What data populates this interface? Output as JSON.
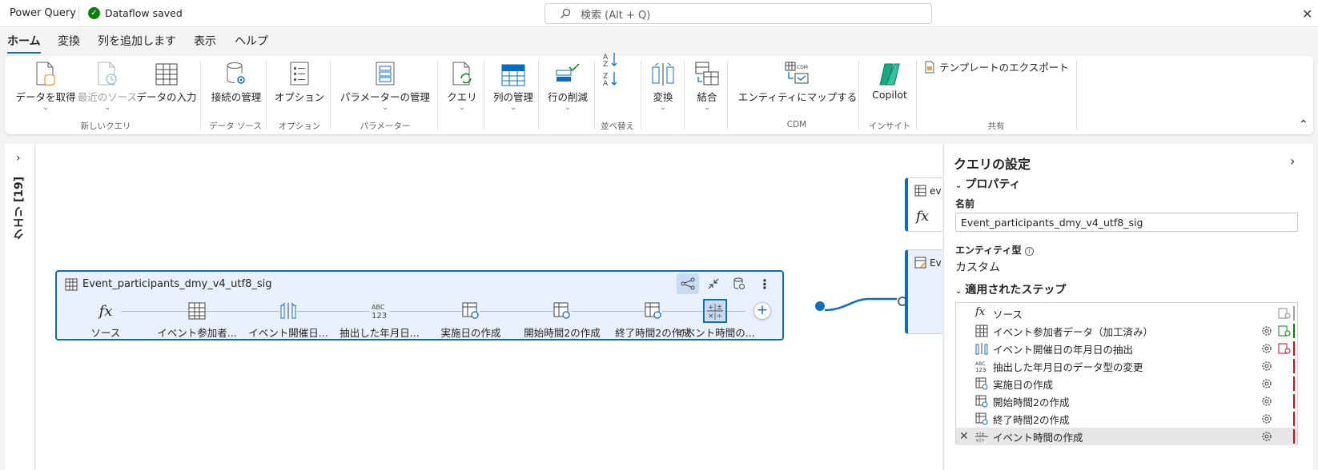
{
  "titlebar": {
    "app_name": "Power Query",
    "save_status": "Dataflow saved",
    "search_placeholder": "検索 (Alt + Q)"
  },
  "tabs": [
    {
      "label": "ホーム",
      "active": true
    },
    {
      "label": "変換"
    },
    {
      "label": "列を追加します"
    },
    {
      "label": "表示"
    },
    {
      "label": "ヘルプ"
    }
  ],
  "ribbon": {
    "get_data": "データを取得",
    "recent_sources": "最近のソース",
    "enter_data": "データの入力",
    "manage_connections": "接続の管理",
    "options": "オプション",
    "manage_parameters": "パラメーターの管理",
    "query": "クエリ",
    "manage_columns": "列の管理",
    "reduce_rows": "行の削減",
    "transform": "変換",
    "combine": "結合",
    "map_to_entity": "エンティティにマップする",
    "copilot": "Copilot",
    "export_template": "テンプレートのエクスポート",
    "groups": {
      "new_query": "新しいクエリ",
      "data_source": "データ ソース",
      "options": "オプション",
      "parameters": "パラメーター",
      "sort": "並べ替え",
      "cdm": "CDM",
      "insight": "インサイト",
      "share": "共有"
    }
  },
  "queries_pane": {
    "label": "クエリ [19]"
  },
  "diagram": {
    "query_name": "Event_participants_dmy_v4_utf8_sig",
    "steps": [
      {
        "label": "ソース",
        "icon": "fx-icon"
      },
      {
        "label": "イベント参加者...",
        "icon": "table-icon"
      },
      {
        "label": "イベント開催日...",
        "icon": "split-column-icon"
      },
      {
        "label": "抽出した年月日...",
        "icon": "abc123-icon"
      },
      {
        "label": "実施日の作成",
        "icon": "custom-column-icon"
      },
      {
        "label": "開始時間2の作成",
        "icon": "custom-column-icon"
      },
      {
        "label": "終了時間2の作成",
        "icon": "custom-column-icon"
      },
      {
        "label": "イベント時間の...",
        "icon": "formula-icon",
        "selected": true
      }
    ],
    "partial_cards": [
      {
        "title": "ev"
      },
      {
        "title": "Ev"
      }
    ]
  },
  "settings": {
    "title": "クエリの設定",
    "properties_header": "プロパティ",
    "name_label": "名前",
    "name_value": "Event_participants_dmy_v4_utf8_sig",
    "entity_type_label": "エンティティ型",
    "entity_type_value": "カスタム",
    "applied_steps_header": "適用されたステップ",
    "applied_steps": [
      {
        "label": "ソース",
        "icon": "fx-icon"
      },
      {
        "label": "イベント参加者データ（加工済み）",
        "icon": "table-icon"
      },
      {
        "label": "イベント開催日の年月日の抽出",
        "icon": "split-column-icon"
      },
      {
        "label": "抽出した年月日のデータ型の変更",
        "icon": "abc123-icon"
      },
      {
        "label": "実施日の作成",
        "icon": "custom-column-icon"
      },
      {
        "label": "開始時間2の作成",
        "icon": "custom-column-icon"
      },
      {
        "label": "終了時間2の作成",
        "icon": "custom-column-icon"
      },
      {
        "label": "イベント時間の作成",
        "icon": "formula-icon",
        "selected": true
      }
    ]
  },
  "colors": {
    "accent": "#0f6cbd",
    "success": "#107c10",
    "warning_bar": "#c50f1f"
  }
}
